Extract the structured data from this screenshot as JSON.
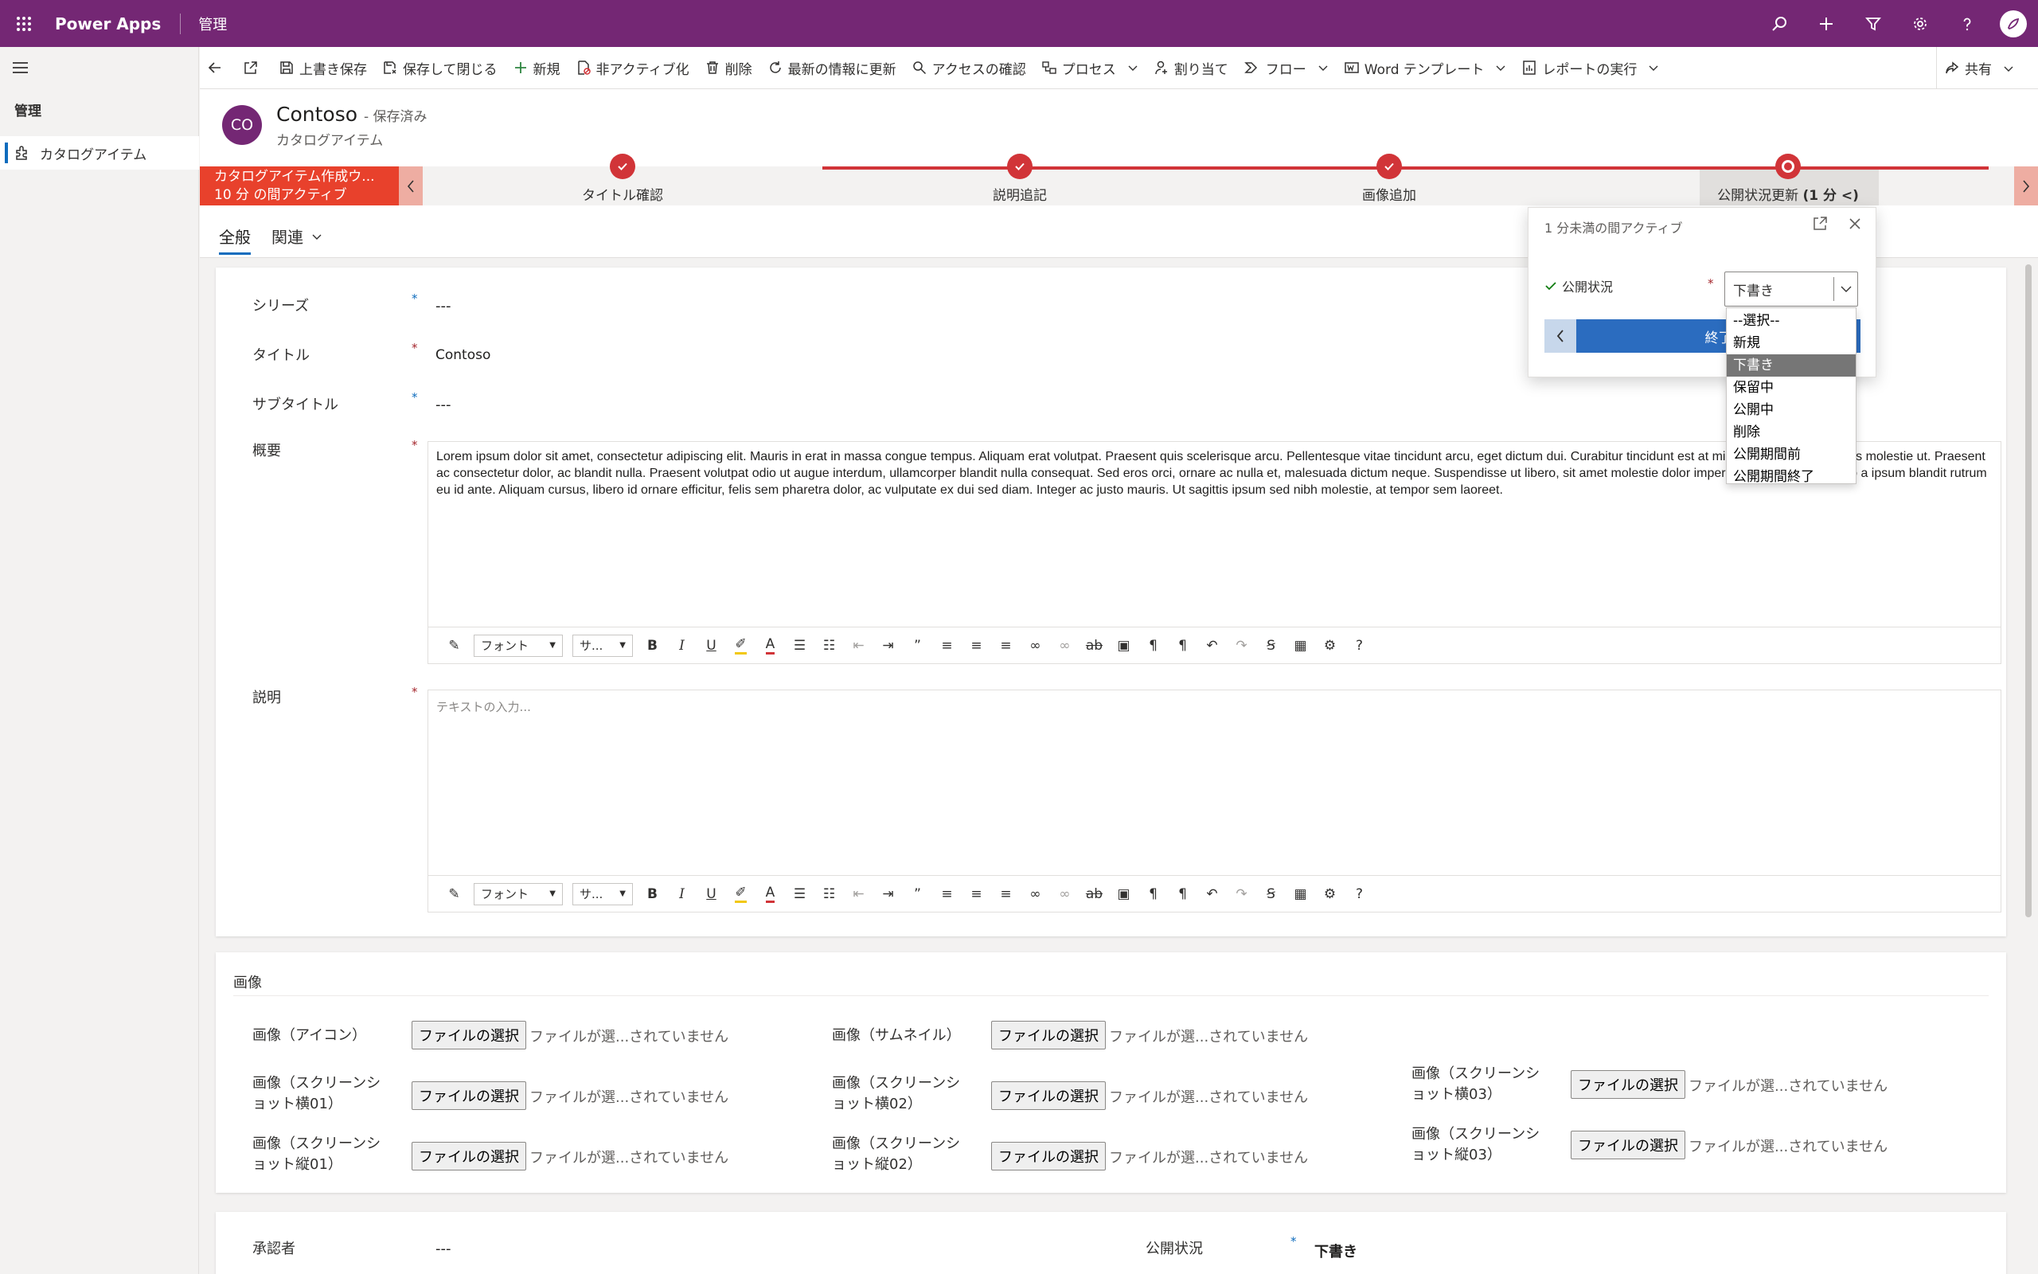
{
  "topbar": {
    "app_name": "Power Apps",
    "area": "管理",
    "icons": [
      "search-icon",
      "plus-icon",
      "filter-icon",
      "gear-icon",
      "help-icon",
      "avatar-icon"
    ]
  },
  "sidebar": {
    "group": "管理",
    "items": [
      {
        "label": "カタログアイテム",
        "icon": "puzzle-icon"
      }
    ]
  },
  "commands": {
    "save": "上書き保存",
    "save_close": "保存して閉じる",
    "new": "新規",
    "deactivate": "非アクティブ化",
    "delete": "削除",
    "refresh": "最新の情報に更新",
    "check_access": "アクセスの確認",
    "process": "プロセス",
    "assign": "割り当て",
    "flow": "フロー",
    "word_template": "Word テンプレート",
    "run_report": "レポートの実行",
    "share": "共有"
  },
  "record": {
    "initials": "CO",
    "title": "Contoso",
    "status": "- 保存済み",
    "entity": "カタログアイテム"
  },
  "bpf": {
    "process_name": "カタログアイテム作成ウ...",
    "process_duration": "10 分 の間アクティブ",
    "stages": [
      {
        "label": "タイトル確認",
        "status": "completed"
      },
      {
        "label": "説明追記",
        "status": "completed"
      },
      {
        "label": "画像追加",
        "status": "completed"
      },
      {
        "label": "公開状況更新",
        "duration": "(1 分 <)",
        "status": "active"
      }
    ]
  },
  "tabs": {
    "general": "全般",
    "related": "関連"
  },
  "form": {
    "series_label": "シリーズ",
    "series_value": "---",
    "title_label": "タイトル",
    "title_value": "Contoso",
    "subtitle_label": "サブタイトル",
    "subtitle_value": "---",
    "summary_label": "概要",
    "summary_text": "Lorem ipsum dolor sit amet, consectetur adipiscing elit. Mauris in erat in massa congue tempus. Aliquam erat volutpat. Praesent quis scelerisque arcu. Pellentesque vitae tincidunt arcu, eget dictum dui. Curabitur tincidunt est at mi laoreet, id auctor metus molestie ut. Praesent ac consectetur dolor, ac blandit nulla. Praesent volutpat odio ut augue interdum, ullamcorper blandit nulla consequat. Sed eros orci, ornare ac nulla et, malesuada dictum neque. Suspendisse ut libero, sit amet molestie dolor imperdiet sed. Morbi eu justo a ipsum blandit rutrum eu id ante. Aliquam cursus, libero id ornare efficitur, felis sem pharetra dolor, ac vulputate ex dui sed diam. Integer ac justo mauris. Ut sagittis ipsum sed nibh molestie, at tempor sem laoreet.",
    "description_label": "説明",
    "description_placeholder": "テキストの入力...",
    "toolbar": {
      "font": "フォント",
      "size": "サ..."
    }
  },
  "images": {
    "section_title": "画像",
    "choose_file": "ファイルの選択",
    "no_file": "ファイルが選...されていません",
    "icon_label": "画像（アイコン）",
    "thumb_label": "画像（サムネイル）",
    "h01_label_a": "画像（スクリーンシ",
    "h01_label_b": "ョット横01）",
    "h02_label_a": "画像（スクリーンシ",
    "h02_label_b": "ョット横02）",
    "h03_label_a": "画像（スクリーンシ",
    "h03_label_b": "ョット横03）",
    "v01_label_a": "画像（スクリーンシ",
    "v01_label_b": "ョット縦01）",
    "v02_label_a": "画像（スクリーンシ",
    "v02_label_b": "ョット縦02）",
    "v03_label_a": "画像（スクリーンシ",
    "v03_label_b": "ョット縦03）"
  },
  "bottom": {
    "approver_label": "承認者",
    "approver_value": "---",
    "pub_label": "公開状況",
    "pub_value": "下書き"
  },
  "flyout": {
    "status": "1 分未満の間アクティブ",
    "field_label": "公開状況",
    "field_value": "下書き",
    "finish": "終了"
  },
  "dropdown": {
    "options": [
      "--選択--",
      "新規",
      "下書き",
      "保留中",
      "公開中",
      "削除",
      "公開期間前",
      "公開期間終了"
    ],
    "selected_index": 2
  },
  "colors": {
    "brand": "#742774",
    "bpf_red": "#d13438",
    "accent": "#0f6cbd"
  }
}
